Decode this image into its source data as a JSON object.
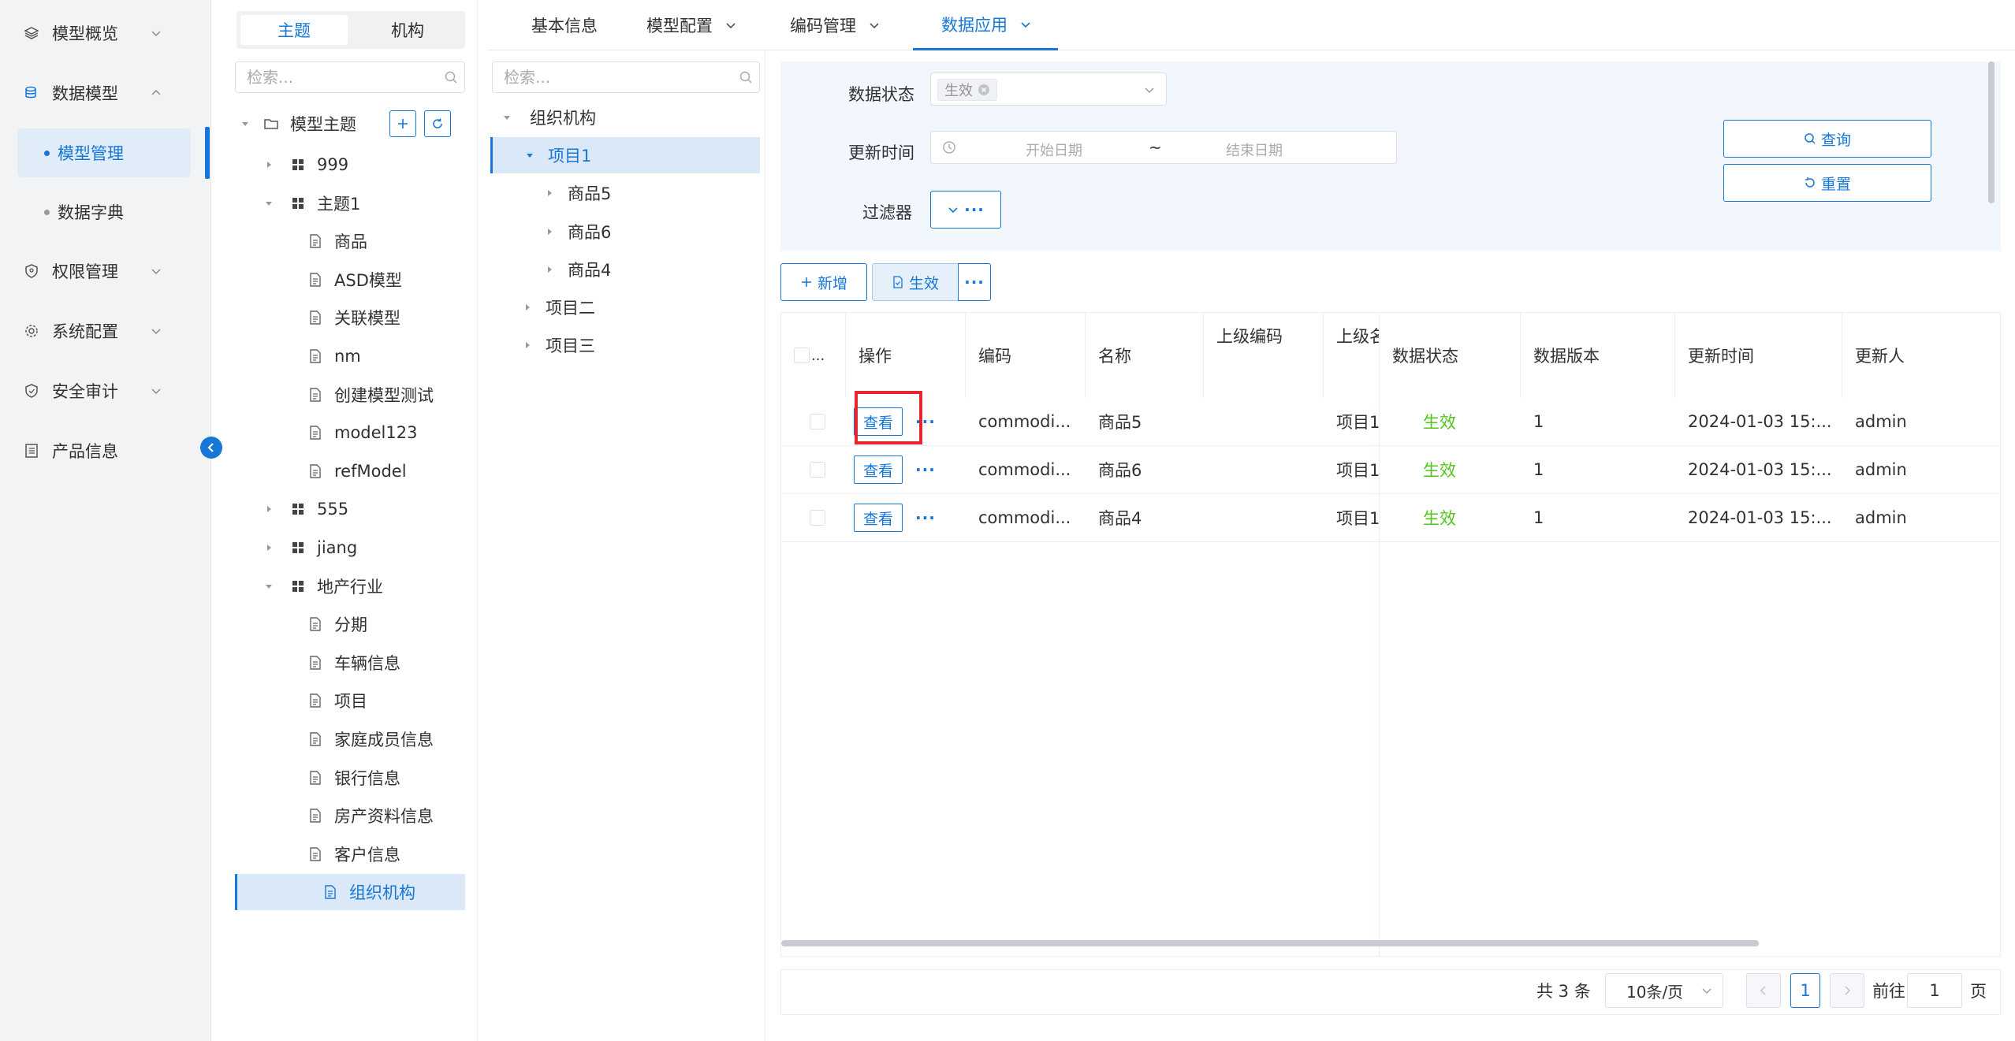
{
  "nav": {
    "items": [
      {
        "label": "模型概览",
        "icon": "layers-icon"
      },
      {
        "label": "数据模型",
        "icon": "database-icon"
      },
      {
        "label": "权限管理",
        "icon": "shield-icon"
      },
      {
        "label": "系统配置",
        "icon": "gear-icon"
      },
      {
        "label": "安全审计",
        "icon": "shield-check-icon"
      },
      {
        "label": "产品信息",
        "icon": "document-list-icon"
      }
    ],
    "sub_items": [
      {
        "label": "模型管理",
        "active": true
      },
      {
        "label": "数据字典",
        "active": false
      }
    ],
    "accent": "#1677d7"
  },
  "segmented": {
    "options": [
      "主题",
      "机构"
    ],
    "active": "主题"
  },
  "tree_search": {
    "placeholder": "检索..."
  },
  "theme_tree": {
    "root": "模型主题",
    "nodes": [
      {
        "label": "999",
        "level": 1,
        "type": "group",
        "expanded": false
      },
      {
        "label": "主题1",
        "level": 1,
        "type": "group",
        "expanded": true
      },
      {
        "label": "商品",
        "level": 2,
        "type": "doc"
      },
      {
        "label": "ASD模型",
        "level": 2,
        "type": "doc"
      },
      {
        "label": "关联模型",
        "level": 2,
        "type": "doc"
      },
      {
        "label": "nm",
        "level": 2,
        "type": "doc"
      },
      {
        "label": "创建模型测试",
        "level": 2,
        "type": "doc"
      },
      {
        "label": "model123",
        "level": 2,
        "type": "doc"
      },
      {
        "label": "refModel",
        "level": 2,
        "type": "doc"
      },
      {
        "label": "555",
        "level": 1,
        "type": "group",
        "expanded": false
      },
      {
        "label": "jiang",
        "level": 1,
        "type": "group",
        "expanded": false
      },
      {
        "label": "地产行业",
        "level": 1,
        "type": "group",
        "expanded": true
      },
      {
        "label": "分期",
        "level": 2,
        "type": "doc"
      },
      {
        "label": "车辆信息",
        "level": 2,
        "type": "doc"
      },
      {
        "label": "项目",
        "level": 2,
        "type": "doc"
      },
      {
        "label": "家庭成员信息",
        "level": 2,
        "type": "doc"
      },
      {
        "label": "银行信息",
        "level": 2,
        "type": "doc"
      },
      {
        "label": "房产资料信息",
        "level": 2,
        "type": "doc"
      },
      {
        "label": "客户信息",
        "level": 2,
        "type": "doc"
      },
      {
        "label": "组织机构",
        "level": 2,
        "type": "doc",
        "selected": true
      }
    ]
  },
  "org_search": {
    "placeholder": "检索..."
  },
  "org_tree": {
    "nodes": [
      {
        "label": "组织机构",
        "level": 0,
        "expanded": true
      },
      {
        "label": "项目1",
        "level": 1,
        "expanded": true,
        "selected": true
      },
      {
        "label": "商品5",
        "level": 2,
        "expanded": false
      },
      {
        "label": "商品6",
        "level": 2,
        "expanded": false
      },
      {
        "label": "商品4",
        "level": 2,
        "expanded": false
      },
      {
        "label": "项目二",
        "level": 1,
        "expanded": false
      },
      {
        "label": "项目三",
        "level": 1,
        "expanded": false
      }
    ]
  },
  "tabs": [
    {
      "label": "基本信息",
      "dropdown": false,
      "active": false
    },
    {
      "label": "模型配置",
      "dropdown": true,
      "active": false
    },
    {
      "label": "编码管理",
      "dropdown": true,
      "active": false
    },
    {
      "label": "数据应用",
      "dropdown": true,
      "active": true
    }
  ],
  "filter": {
    "status_label": "数据状态",
    "status_tag": "生效",
    "time_label": "更新时间",
    "start_placeholder": "开始日期",
    "range_sep": "~",
    "end_placeholder": "结束日期",
    "filter_label": "过滤器",
    "query": "查询",
    "reset": "重置",
    "more": "···"
  },
  "toolbar": {
    "add": "新增",
    "activate": "生效",
    "more": "···"
  },
  "table": {
    "select_all": "...",
    "columns": [
      "操作",
      "编码",
      "名称",
      "上级编码",
      "上级名",
      "数据状态",
      "数据版本",
      "更新时间",
      "更新人"
    ],
    "view_label": "查看",
    "more_label": "···",
    "rows": [
      {
        "code": "commodi...",
        "name": "商品5",
        "parent_code": "",
        "parent_name": "项目1",
        "status": "生效",
        "version": "1",
        "updated": "2024-01-03 15:...",
        "user": "admin"
      },
      {
        "code": "commodi...",
        "name": "商品6",
        "parent_code": "",
        "parent_name": "项目1",
        "status": "生效",
        "version": "1",
        "updated": "2024-01-03 15:...",
        "user": "admin"
      },
      {
        "code": "commodi...",
        "name": "商品4",
        "parent_code": "",
        "parent_name": "项目1",
        "status": "生效",
        "version": "1",
        "updated": "2024-01-03 15:...",
        "user": "admin"
      }
    ],
    "status_color": "#52c41a"
  },
  "pager": {
    "total": "共 3 条",
    "page_size": "10条/页",
    "current": "1",
    "goto_label": "前往",
    "goto_value": "1",
    "page_unit": "页"
  }
}
